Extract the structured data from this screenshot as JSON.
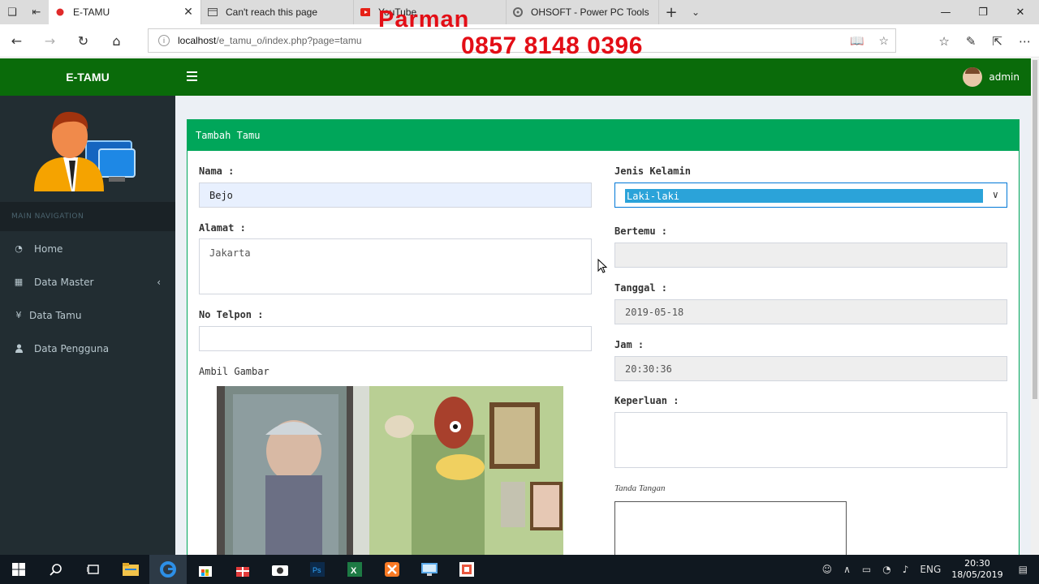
{
  "browser": {
    "tabs": [
      {
        "title": "E-TAMU",
        "active": true
      },
      {
        "title": "Can't reach this page",
        "active": false
      },
      {
        "title": "YouTube",
        "active": false
      },
      {
        "title": "OHSOFT - Power PC Tools",
        "active": false
      }
    ],
    "url_prefix": "localhost",
    "url_rest": "/e_tamu_o/index.php?page=tamu"
  },
  "watermark": {
    "name": "Parman",
    "phone": "0857 8148 0396"
  },
  "header": {
    "brand": "E-TAMU",
    "user": "admin",
    "color": "#0a6b0a"
  },
  "sidebar": {
    "section": "MAIN NAVIGATION",
    "items": [
      {
        "label": "Home",
        "icon": "dashboard-icon"
      },
      {
        "label": "Data Master",
        "icon": "table-icon"
      },
      {
        "label": "Data Tamu",
        "icon": "yen-icon"
      },
      {
        "label": "Data Pengguna",
        "icon": "user-icon"
      }
    ]
  },
  "form": {
    "title": "Tambah Tamu",
    "nama_label": "Nama :",
    "nama_value": "Bejo",
    "alamat_label": "Alamat :",
    "alamat_value": "Jakarta",
    "telpon_label": "No Telpon :",
    "telpon_value": "",
    "gambar_label": "Ambil Gambar",
    "kelamin_label": "Jenis Kelamin",
    "kelamin_value": "Laki-laki",
    "bertemu_label": "Bertemu :",
    "bertemu_value": "",
    "tanggal_label": "Tanggal :",
    "tanggal_value": "2019-05-18",
    "jam_label": "Jam :",
    "jam_value": "20:30:36",
    "keperluan_label": "Keperluan :",
    "keperluan_value": "",
    "ttd_label": "Tanda Tangan",
    "accent": "#00a65a"
  },
  "taskbar": {
    "lang": "ENG",
    "time": "20:30",
    "date": "18/05/2019"
  }
}
